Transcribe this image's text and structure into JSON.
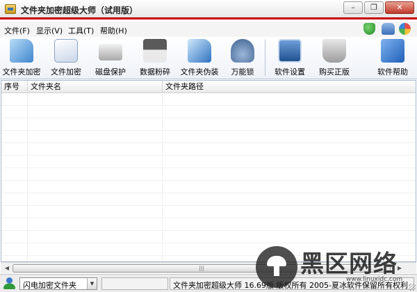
{
  "window": {
    "title": "文件夹加密超级大师（试用版）",
    "minimize_glyph": "–",
    "restore_glyph": "❐",
    "close_glyph": "✕"
  },
  "menu": {
    "items": [
      "文件(F)",
      "显示(V)",
      "工具(T)",
      "帮助(H)"
    ],
    "tray_icons": [
      "shield-check-icon",
      "telephone-icon",
      "color-wheel-icon"
    ]
  },
  "toolbar": {
    "buttons": [
      {
        "label": "文件夹加密",
        "icon": "folder-encrypt-icon"
      },
      {
        "label": "文件加密",
        "icon": "file-encrypt-icon"
      },
      {
        "label": "磁盘保护",
        "icon": "disk-protect-icon"
      },
      {
        "label": "数据粉碎",
        "icon": "shredder-icon"
      },
      {
        "label": "文件夹伪装",
        "icon": "folder-disguise-icon"
      },
      {
        "label": "万能锁",
        "icon": "padlock-icon"
      },
      {
        "label": "软件设置",
        "icon": "settings-board-icon"
      },
      {
        "label": "购买正版",
        "icon": "shopping-cart-icon"
      },
      {
        "label": "软件帮助",
        "icon": "help-cube-icon"
      }
    ]
  },
  "list": {
    "columns": [
      "序号",
      "文件夹名",
      "文件夹路径"
    ],
    "rows": []
  },
  "scrollbar": {
    "left_glyph": "◀",
    "right_glyph": "▶",
    "thumb_grip": "|||"
  },
  "status": {
    "mode_selected": "闪电加密文件夹",
    "dropdown_glyph": "▼",
    "middle_text": "",
    "copyright": "文件夹加密超级大师 16.69版 版权所有 2005-夏冰软件保留所有权利"
  },
  "watermark": {
    "brand": "黑区网络",
    "url": "www.linuxidc.com"
  },
  "colors": {
    "accent_red": "#c80000",
    "close_button": "#c0392b",
    "toolbar_blue": "#3a6fb3"
  }
}
